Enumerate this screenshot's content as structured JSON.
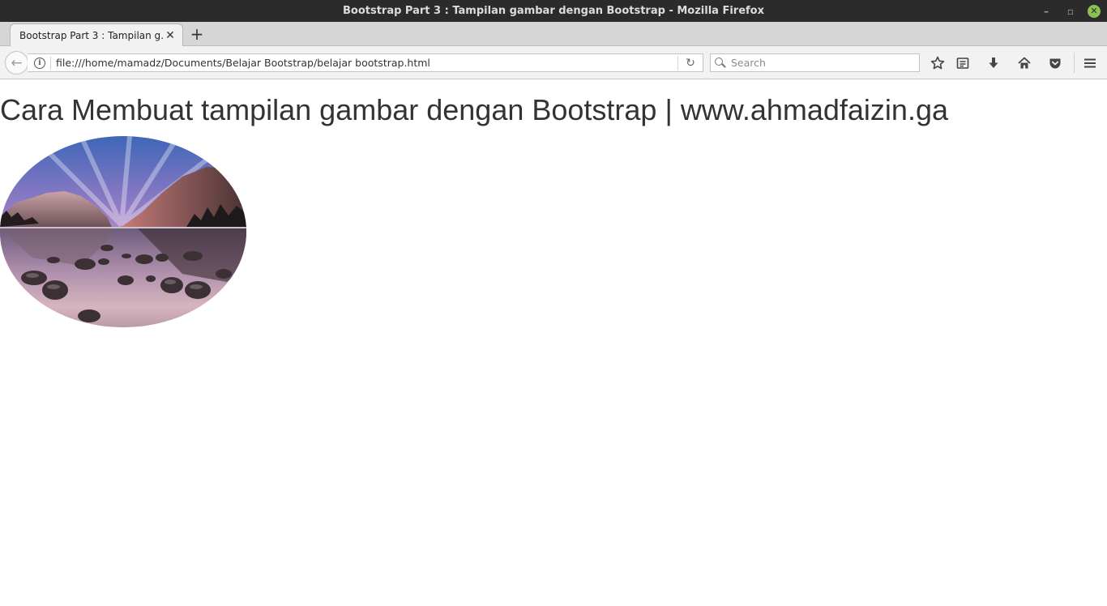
{
  "window": {
    "title": "Bootstrap Part 3 : Tampilan gambar dengan Bootstrap - Mozilla Firefox",
    "controls": {
      "minimize": "–",
      "restore": "▫",
      "close": "✕"
    }
  },
  "tabs": [
    {
      "label": "Bootstrap Part 3 : Tampilan g…",
      "close": "✕",
      "active": true
    }
  ],
  "tabstrip": {
    "new_tab": "+"
  },
  "navbar": {
    "back": "←",
    "info": "i",
    "url": "file:///home/mamadz/Documents/Belajar Bootstrap/belajar bootstrap.html",
    "reload": "↻",
    "search_placeholder": "Search",
    "icons": [
      "bookmark-star-icon",
      "reading-list-icon",
      "download-icon",
      "home-icon",
      "pocket-icon",
      "menu-icon"
    ]
  },
  "page": {
    "heading": "Cara Membuat tampilan gambar dengan Bootstrap | www.ahmadfaizin.ga",
    "image": {
      "description_icon": "landscape-image",
      "shape": "ellipse"
    }
  },
  "colors": {
    "titlebar_bg": "#2b2b2b",
    "tabstrip_bg": "#d6d6d6",
    "navbar_bg": "#f2f2f2",
    "close_button": "#8cc152",
    "heading_text": "#333333"
  }
}
